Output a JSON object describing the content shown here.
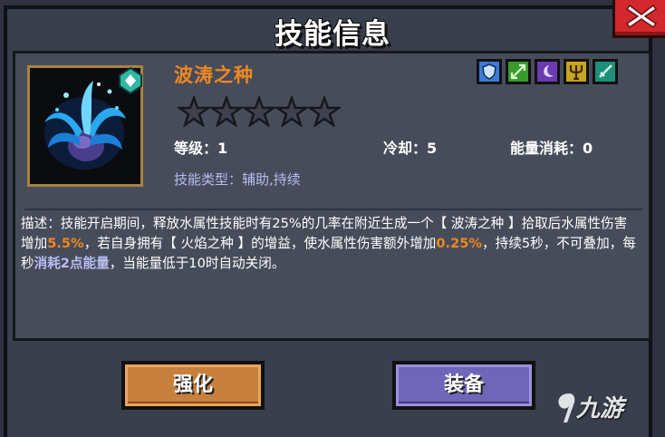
{
  "window": {
    "title": "技能信息"
  },
  "skill": {
    "name": "波涛之种",
    "stars_filled": 0,
    "stars_total": 5,
    "level_label": "等级：",
    "level_value": "1",
    "cooldown_label": "冷却：",
    "cooldown_value": "5",
    "energy_label": "能量消耗：",
    "energy_value": "0",
    "type_label": "技能类型：",
    "type_value": "辅助,持续",
    "badges": [
      {
        "icon": "shield-icon",
        "color": "#3d7ad6"
      },
      {
        "icon": "arrows-icon",
        "color": "#3a9a2e"
      },
      {
        "icon": "moon-icon",
        "color": "#6a3bb0"
      },
      {
        "icon": "trident-icon",
        "color": "#c9a421"
      },
      {
        "icon": "sword-icon",
        "color": "#1f8f7a"
      }
    ]
  },
  "description": {
    "prefix": "描述：技能开启期间，释放水属性技能时有25%的几率在附近生成一个【 波涛之种 】拾取后水属性伤害增加",
    "val1": "5.5%",
    "mid1": "，若自身拥有【 火焰之种 】的增益，使水属性伤害额外增加",
    "val2": "0.25%",
    "mid2": "，持续5秒，不可叠加，每秒",
    "cost": "消耗2点能量",
    "suffix": "，当能量低于10时自动关闭。"
  },
  "buttons": {
    "upgrade": "强化",
    "equip": "装备"
  },
  "watermark": {
    "text": "九游"
  },
  "colors": {
    "accent_orange": "#f0891f",
    "accent_lavender": "#b7bdf0",
    "close_red": "#d3282d"
  }
}
